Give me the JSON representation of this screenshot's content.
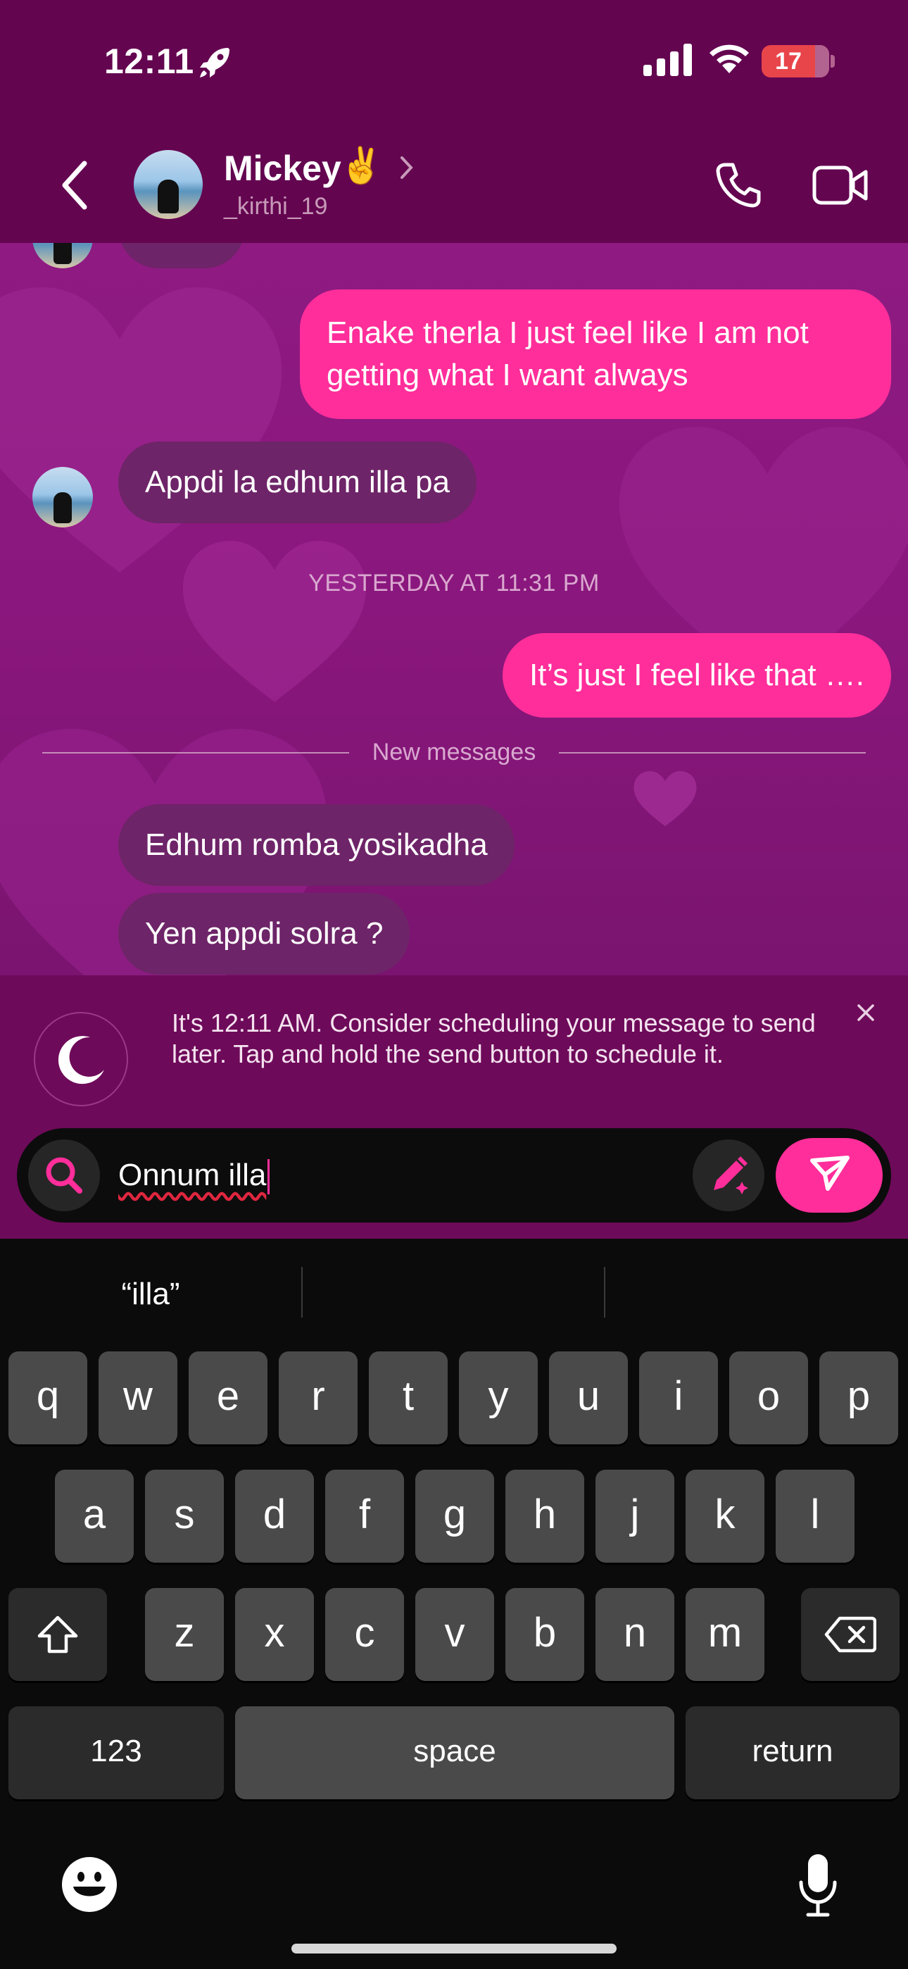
{
  "status_bar": {
    "time": "12:11",
    "battery": "17",
    "icons": [
      "rocket-icon",
      "cellular-signal-icon",
      "wifi-icon",
      "battery-icon"
    ]
  },
  "header": {
    "contact_name": "Mickey",
    "contact_emoji": "✌️",
    "username": "_kirthi_19",
    "icons": [
      "back-chevron-icon",
      "chevron-right-icon",
      "phone-icon",
      "video-camera-icon"
    ]
  },
  "messages": [
    {
      "id": "m1",
      "direction": "outgoing",
      "text": "Enake therla I just feel like I am not getting what I want always"
    },
    {
      "id": "m2",
      "direction": "incoming",
      "text": "Appdi la edhum illa pa"
    },
    {
      "id": "ts",
      "type": "timestamp",
      "text": "YESTERDAY AT 11:31 PM"
    },
    {
      "id": "m3",
      "direction": "outgoing",
      "text": "It’s just I feel like that …."
    },
    {
      "id": "nm",
      "type": "divider",
      "text": "New messages"
    },
    {
      "id": "m4",
      "direction": "incoming",
      "text": "Edhum romba yosikadha"
    },
    {
      "id": "m5",
      "direction": "incoming",
      "text": "Yen appdi solra ?"
    }
  ],
  "tip": {
    "text": "It's 12:11 AM. Consider scheduling your message to send later. Tap and hold the send button to schedule it.",
    "icons": [
      "moon-icon",
      "close-icon"
    ]
  },
  "composer": {
    "value": "Onnum illa",
    "icons": [
      "search-icon",
      "pencil-sparkle-icon",
      "send-icon"
    ]
  },
  "keyboard": {
    "suggestions": [
      "“illa”",
      "",
      ""
    ],
    "row1": [
      "q",
      "w",
      "e",
      "r",
      "t",
      "y",
      "u",
      "i",
      "o",
      "p"
    ],
    "row2": [
      "a",
      "s",
      "d",
      "f",
      "g",
      "h",
      "j",
      "k",
      "l"
    ],
    "row3": [
      "z",
      "x",
      "c",
      "v",
      "b",
      "n",
      "m"
    ],
    "numbers_label": "123",
    "space_label": "space",
    "return_label": "return",
    "icons": [
      "shift-icon",
      "backspace-icon",
      "emoji-icon",
      "microphone-icon"
    ]
  },
  "colors": {
    "header_bg": "#640550",
    "outgoing_bubble": "#ff2e9a",
    "incoming_bubble": "#6e2468",
    "tip_bg": "#6e0a5a",
    "key_bg": "#4a4a4a"
  }
}
